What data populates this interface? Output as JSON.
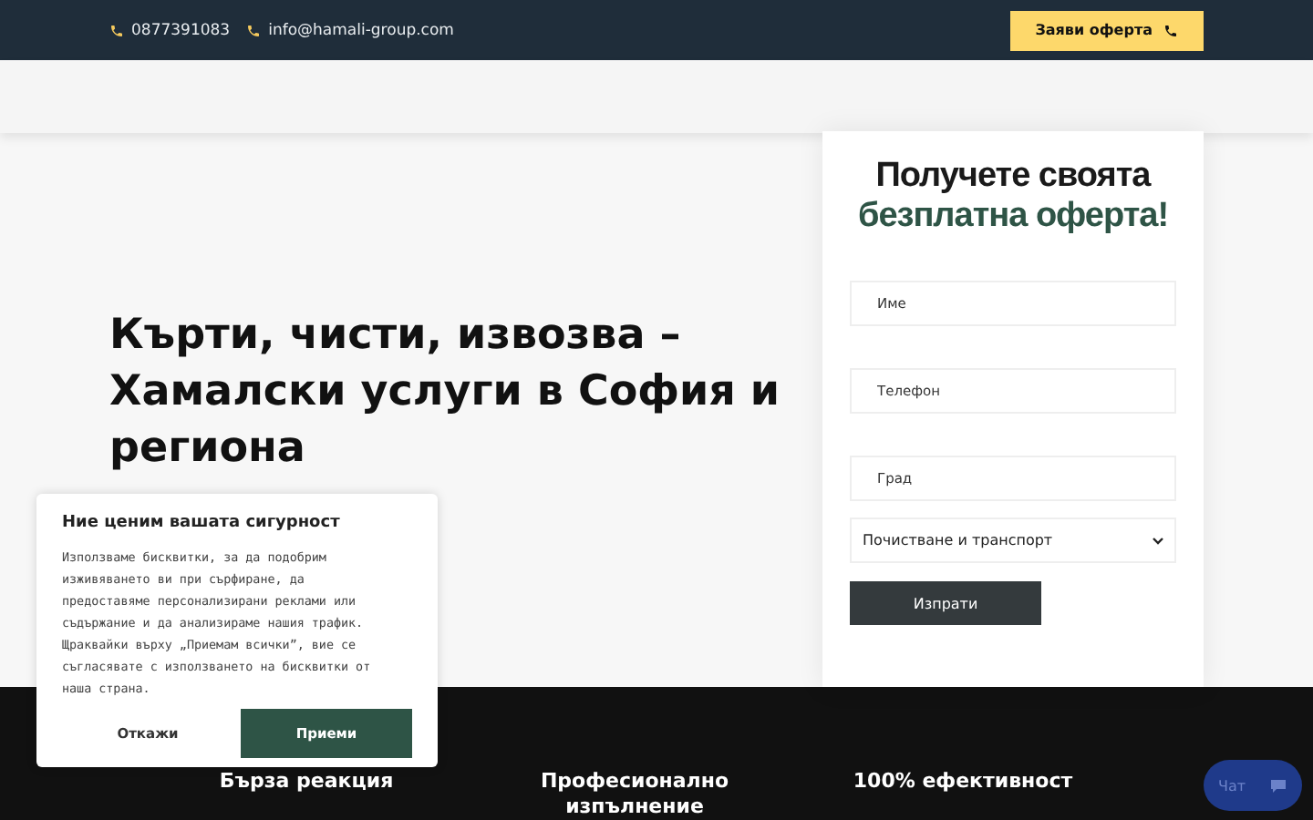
{
  "top_bar": {
    "phone": "0877391083",
    "email": "info@hamali-group.com",
    "cta_button": "Заяви оферта"
  },
  "hero": {
    "heading": "Кърти, чисти, извозва – Хамалски услуги в София и региона"
  },
  "quote_form": {
    "title_line_1": "Получете своята",
    "title_line_2": "безплатна оферта!",
    "fields": [
      {
        "placeholder": "Име"
      },
      {
        "placeholder": "Телефон"
      },
      {
        "placeholder": "Град"
      }
    ],
    "service_select": "Почистване и транспорт",
    "submit_button": "Изпрати"
  },
  "features": [
    {
      "title": "Бърза реакция"
    },
    {
      "title": "Професионално изпълнение"
    },
    {
      "title": "100% ефективност"
    }
  ],
  "cookie_banner": {
    "title": "Ние ценим вашата сигурност",
    "text": "Използваме бисквитки, за да подобрим изживяването ви при сърфиране, да предоставяме персонализирани реклами или съдържание и да анализираме нашия трафик. Щраквайки върху „Приемам всички”, вие се съгласявате с използването на бисквитки от наша страна.",
    "reject_button": "Откажи",
    "accept_button": "Приеми"
  },
  "chat_button": {
    "label": "Чат"
  }
}
